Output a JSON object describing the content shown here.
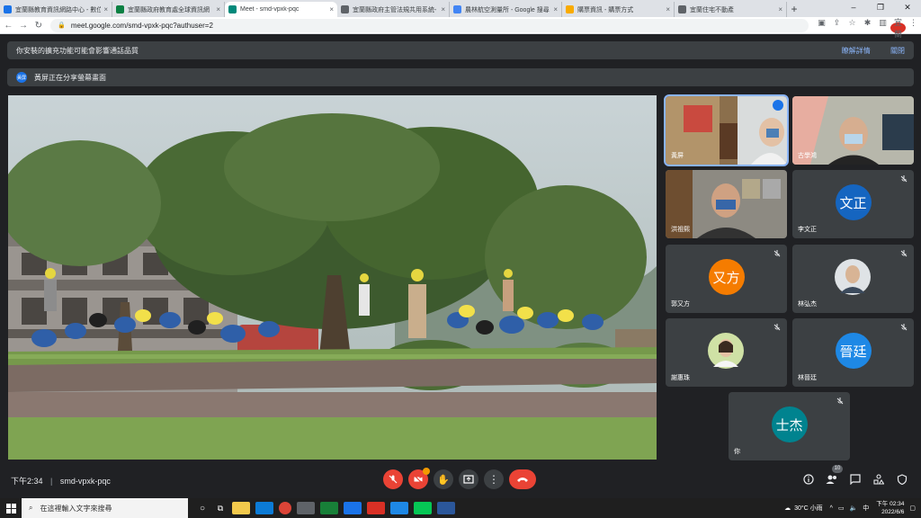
{
  "browser": {
    "tabs": [
      {
        "title": "宜蘭縣教育資訊網路中心 - 數位",
        "color": "#1a73e8"
      },
      {
        "title": "宜蘭縣政府教育處全球資訊網",
        "color": "#0b8043"
      },
      {
        "title": "Meet - smd-vpxk-pqc",
        "color": "#00897b",
        "active": true
      },
      {
        "title": "宜蘭縣政府主管法規共用系統-",
        "color": "#5f6368"
      },
      {
        "title": "農林航空測量所 - Google 搜尋",
        "color": "#4285f4"
      },
      {
        "title": "購票資訊 - 購票方式",
        "color": "#f9ab00"
      },
      {
        "title": "宜蘭住宅不動產",
        "color": "#5f6368"
      }
    ],
    "url": "meet.google.com/smd-vpxk-pqc?authuser=2",
    "profile_initials": "宜蘭"
  },
  "meet": {
    "warning_banner": {
      "text": "你安裝的擴充功能可能會影響通話品質",
      "details_link": "瞭解詳情",
      "close_link": "關閉"
    },
    "presenting_banner": {
      "badge": "黃屏",
      "text": "黃屏正在分享螢幕畫面"
    },
    "participants": [
      {
        "name": "黃屏",
        "type": "video",
        "active": true
      },
      {
        "name": "古學鴻",
        "type": "video"
      },
      {
        "name": "洪祖熙",
        "type": "video"
      },
      {
        "name": "李文正",
        "type": "avatar",
        "initials": "文正",
        "color": "#1565c0"
      },
      {
        "name": "郭又方",
        "type": "avatar",
        "initials": "又方",
        "color": "#f57c00"
      },
      {
        "name": "林弘杰",
        "type": "photo"
      },
      {
        "name": "謝惠珠",
        "type": "photo"
      },
      {
        "name": "林晉廷",
        "type": "avatar",
        "initials": "晉廷",
        "color": "#1e88e5"
      },
      {
        "name": "你",
        "type": "avatar",
        "initials": "士杰",
        "color": "#00838f"
      }
    ],
    "time": "下午2:34",
    "meeting_code": "smd-vpxk-pqc",
    "participant_count": "10"
  },
  "taskbar": {
    "search_placeholder": "在這裡輸入文字來搜尋",
    "weather": "30°C 小雨",
    "clock_time": "下午 02:34",
    "clock_date": "2022/6/6"
  }
}
